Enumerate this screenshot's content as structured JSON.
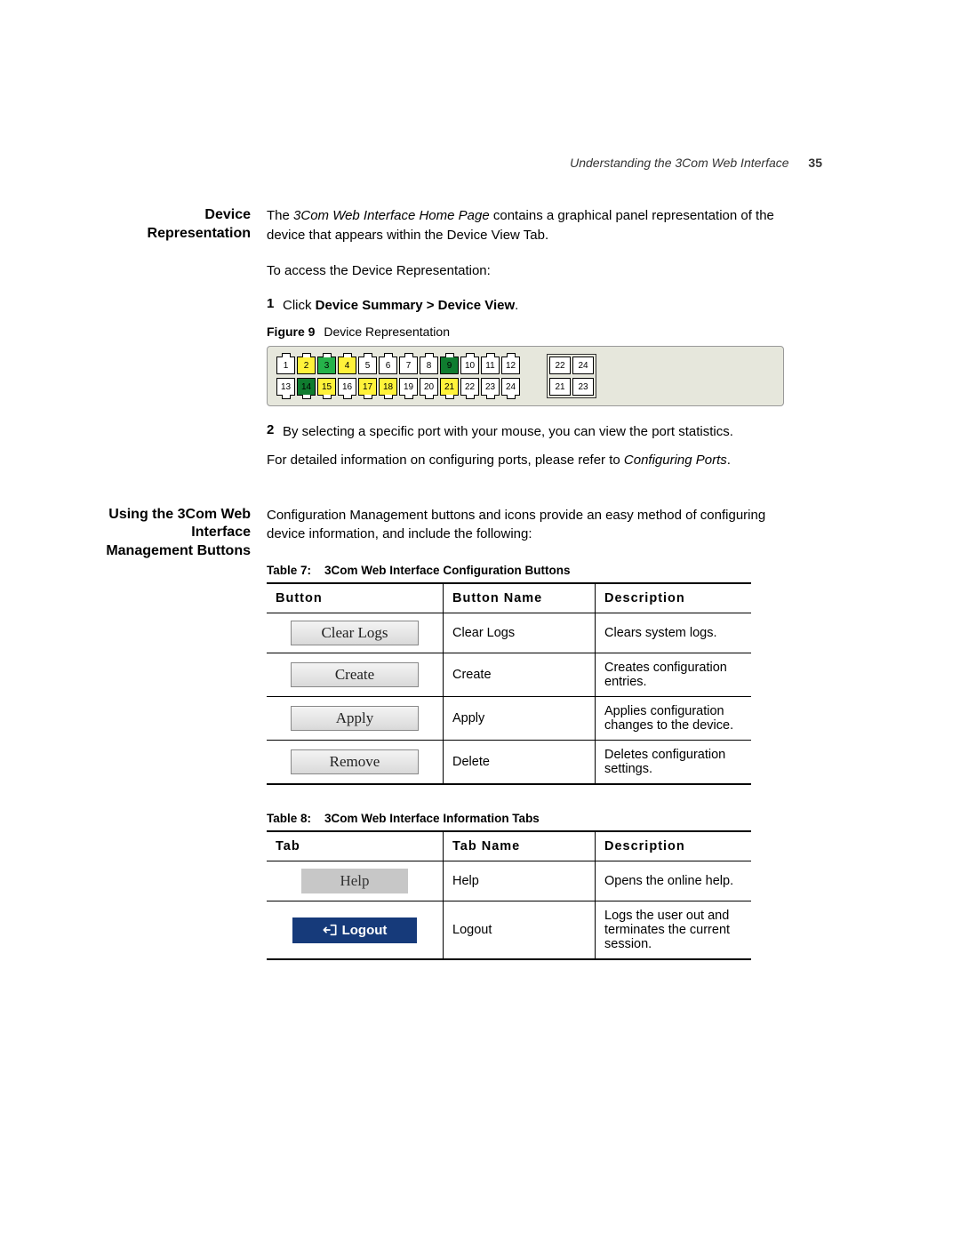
{
  "header": {
    "running_title": "Understanding the 3Com Web Interface",
    "page_number": "35"
  },
  "section1": {
    "side_heading_l1": "Device",
    "side_heading_l2": "Representation",
    "para1_pre": "The ",
    "para1_em": "3Com Web Interface Home Page",
    "para1_post": " contains a graphical panel representation of the device that appears within the Device View Tab.",
    "para2": "To access the Device Representation:",
    "step1_num": "1",
    "step1_pre": "Click ",
    "step1_bold": "Device Summary > Device View",
    "step1_post": ".",
    "fig_label": "Figure 9",
    "fig_caption": "Device Representation",
    "ports_top": [
      {
        "n": "1",
        "c": ""
      },
      {
        "n": "2",
        "c": "yellow"
      },
      {
        "n": "3",
        "c": "green"
      },
      {
        "n": "4",
        "c": "yellow"
      },
      {
        "n": "5",
        "c": ""
      },
      {
        "n": "6",
        "c": ""
      },
      {
        "n": "7",
        "c": ""
      },
      {
        "n": "8",
        "c": ""
      },
      {
        "n": "9",
        "c": "dgreen"
      },
      {
        "n": "10",
        "c": ""
      },
      {
        "n": "11",
        "c": ""
      },
      {
        "n": "12",
        "c": ""
      }
    ],
    "ports_bottom": [
      {
        "n": "13",
        "c": ""
      },
      {
        "n": "14",
        "c": "dgreen"
      },
      {
        "n": "15",
        "c": "yellow"
      },
      {
        "n": "16",
        "c": ""
      },
      {
        "n": "17",
        "c": "yellow"
      },
      {
        "n": "18",
        "c": "yellow"
      },
      {
        "n": "19",
        "c": ""
      },
      {
        "n": "20",
        "c": ""
      },
      {
        "n": "21",
        "c": "yellow"
      },
      {
        "n": "22",
        "c": ""
      },
      {
        "n": "23",
        "c": ""
      },
      {
        "n": "24",
        "c": ""
      }
    ],
    "aux_top": [
      "22",
      "24"
    ],
    "aux_bottom": [
      "21",
      "23"
    ],
    "step2_num": "2",
    "step2_text": "By selecting a specific port with your mouse, you can view the port statistics.",
    "para3_pre": "For detailed information on configuring ports, please refer to ",
    "para3_em": "Configuring Ports",
    "para3_post": "."
  },
  "section2": {
    "side_heading_l1": "Using the 3Com Web",
    "side_heading_l2": "Interface",
    "side_heading_l3": "Management Buttons",
    "intro": "Configuration Management buttons and icons provide an easy method of configuring device information, and include the following:",
    "table7_caption_label": "Table 7:",
    "table7_caption_text": "3Com Web Interface Configuration Buttons",
    "table7_headers": [
      "Button",
      "Button Name",
      "Description"
    ],
    "table7_rows": [
      {
        "btn": "Clear Logs",
        "name": "Clear Logs",
        "desc": "Clears system logs."
      },
      {
        "btn": "Create",
        "name": "Create",
        "desc": "Creates configuration entries."
      },
      {
        "btn": "Apply",
        "name": "Apply",
        "desc": "Applies configuration changes to the device."
      },
      {
        "btn": "Remove",
        "name": "Delete",
        "desc": "Deletes configuration settings."
      }
    ],
    "table8_caption_label": "Table 8:",
    "table8_caption_text": "3Com Web Interface Information Tabs",
    "table8_headers": [
      "Tab",
      "Tab Name",
      "Description"
    ],
    "table8_rows": [
      {
        "tab": "Help",
        "name": "Help",
        "desc": "Opens the online help.",
        "style": "help"
      },
      {
        "tab": "Logout",
        "name": "Logout",
        "desc": "Logs the user out and terminates the current session.",
        "style": "logout"
      }
    ]
  }
}
